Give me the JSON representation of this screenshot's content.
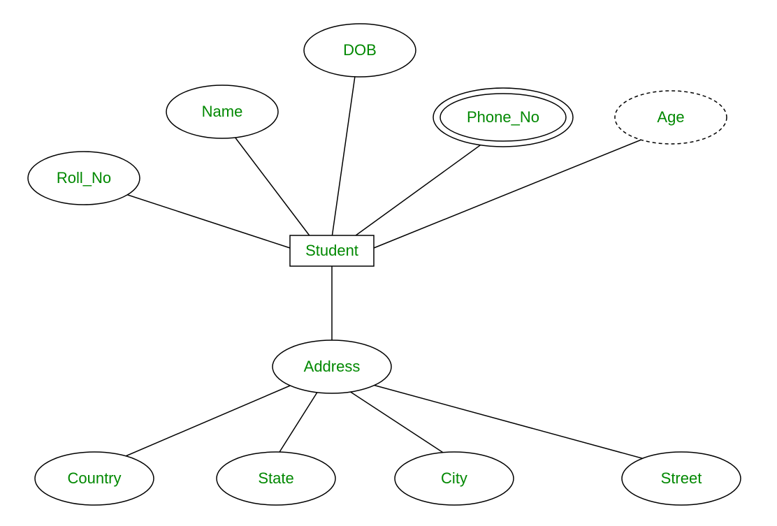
{
  "diagram": {
    "entity": {
      "label": "Student"
    },
    "attributes": {
      "roll_no": {
        "label": "Roll_No",
        "type": "simple"
      },
      "name": {
        "label": "Name",
        "type": "simple"
      },
      "dob": {
        "label": "DOB",
        "type": "simple"
      },
      "phone_no": {
        "label": "Phone_No",
        "type": "multivalued"
      },
      "age": {
        "label": "Age",
        "type": "derived"
      },
      "address": {
        "label": "Address",
        "type": "composite"
      }
    },
    "address_parts": {
      "country": {
        "label": "Country"
      },
      "state": {
        "label": "State"
      },
      "city": {
        "label": "City"
      },
      "street": {
        "label": "Street"
      }
    }
  },
  "chart_data": {
    "type": "er-diagram",
    "entities": [
      {
        "name": "Student"
      }
    ],
    "attributes": [
      {
        "entity": "Student",
        "name": "Roll_No",
        "kind": "simple"
      },
      {
        "entity": "Student",
        "name": "Name",
        "kind": "simple"
      },
      {
        "entity": "Student",
        "name": "DOB",
        "kind": "simple"
      },
      {
        "entity": "Student",
        "name": "Phone_No",
        "kind": "multivalued"
      },
      {
        "entity": "Student",
        "name": "Age",
        "kind": "derived"
      },
      {
        "entity": "Student",
        "name": "Address",
        "kind": "composite",
        "components": [
          "Country",
          "State",
          "City",
          "Street"
        ]
      }
    ]
  }
}
